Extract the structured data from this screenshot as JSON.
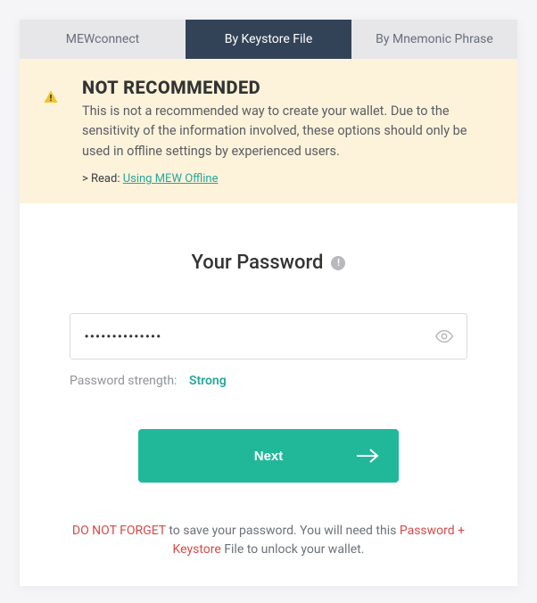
{
  "tabs": {
    "items": [
      {
        "label": "MEWconnect",
        "active": false
      },
      {
        "label": "By Keystore File",
        "active": true
      },
      {
        "label": "By Mnemonic Phrase",
        "active": false
      }
    ]
  },
  "warning": {
    "title": "NOT RECOMMENDED",
    "body": "This is not a recommended way to create your wallet. Due to the sensitivity of the information involved, these options should only be used in offline settings by experienced users.",
    "read_prefix": "> Read: ",
    "read_link": "Using MEW Offline"
  },
  "password": {
    "heading": "Your Password",
    "value": "••••••••••••••",
    "strength_label": "Password strength:",
    "strength_value": "Strong"
  },
  "actions": {
    "next_label": "Next"
  },
  "footer": {
    "part1": "DO NOT FORGET",
    "part2": " to save your password. You will need this ",
    "part3": "Password + Keystore",
    "part4": " File to unlock your wallet."
  }
}
